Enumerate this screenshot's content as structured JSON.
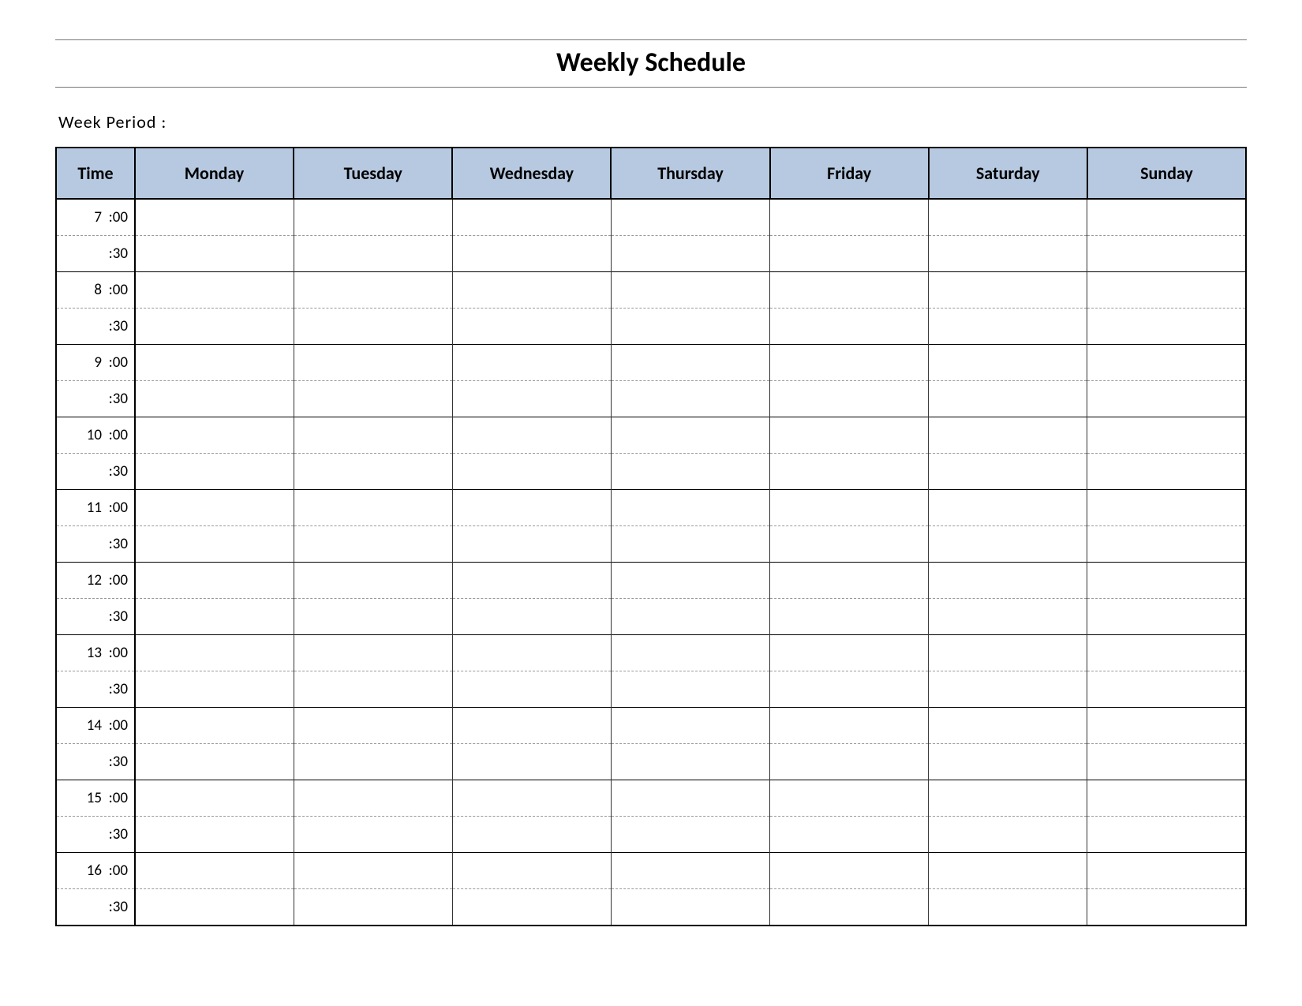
{
  "title": "Weekly Schedule",
  "week_period_label": "Week  Period :",
  "headers": {
    "time": "Time",
    "days": [
      "Monday",
      "Tuesday",
      "Wednesday",
      "Thursday",
      "Friday",
      "Saturday",
      "Sunday"
    ]
  },
  "time_slots": [
    "7  :00",
    ":30",
    "8  :00",
    ":30",
    "9  :00",
    ":30",
    "10  :00",
    ":30",
    "11  :00",
    ":30",
    "12  :00",
    ":30",
    "13  :00",
    ":30",
    "14  :00",
    ":30",
    "15  :00",
    ":30",
    "16  :00",
    ":30"
  ],
  "cells": {}
}
